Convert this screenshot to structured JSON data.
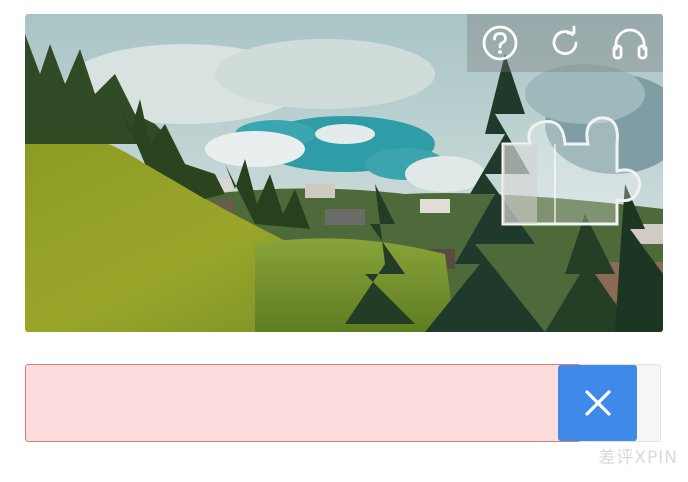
{
  "captcha": {
    "toolbar": {
      "help_icon": "question-circle-icon",
      "refresh_icon": "refresh-icon",
      "audio_icon": "headphones-icon"
    },
    "slider": {
      "state": "error",
      "progress": 0.85,
      "handle_icon": "close-icon",
      "error_color": "#e07a78",
      "fill_color": "#fcdcdc",
      "handle_color": "#3f8ae9"
    }
  },
  "watermark": {
    "text": "差评XPIN"
  }
}
